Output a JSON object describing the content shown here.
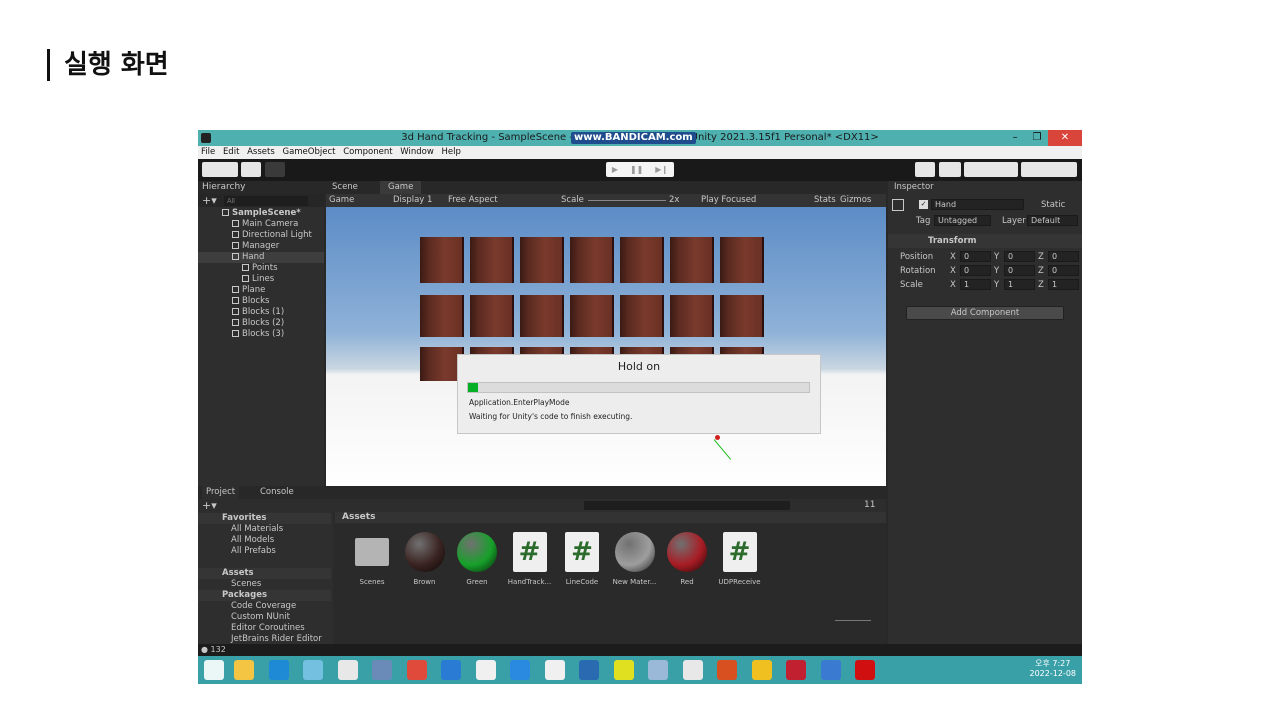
{
  "slide": {
    "title": "실행 화면"
  },
  "window": {
    "title": "3d Hand Tracking - SampleScene - Windows, Mac, Linux - Unity 2021.3.15f1 Personal* <DX11>",
    "watermark": "www.BANDICAM.com",
    "controls": [
      "–",
      "❐",
      "✕"
    ]
  },
  "menu": [
    "File",
    "Edit",
    "Assets",
    "GameObject",
    "Component",
    "Window",
    "Help"
  ],
  "hierarchy": {
    "tab": "Hierarchy",
    "search_placeholder": "All",
    "items": [
      {
        "label": "SampleScene*",
        "level": 0,
        "bold": true
      },
      {
        "label": "Main Camera",
        "level": 1
      },
      {
        "label": "Directional Light",
        "level": 1
      },
      {
        "label": "Manager",
        "level": 1
      },
      {
        "label": "Hand",
        "level": 1,
        "selected": true
      },
      {
        "label": "Points",
        "level": 2
      },
      {
        "label": "Lines",
        "level": 2
      },
      {
        "label": "Plane",
        "level": 1
      },
      {
        "label": "Blocks",
        "level": 1
      },
      {
        "label": "Blocks (1)",
        "level": 1
      },
      {
        "label": "Blocks (2)",
        "level": 1
      },
      {
        "label": "Blocks (3)",
        "level": 1
      }
    ]
  },
  "gameview": {
    "tabs": [
      "Scene",
      "Game"
    ],
    "mode": "Game",
    "display": "Display 1",
    "aspect": "Free Aspect",
    "scale_label": "Scale",
    "scale_value": "2x",
    "play_focused": "Play Focused",
    "stats": "Stats",
    "gizmos": "Gizmos"
  },
  "dialog": {
    "title": "Hold on",
    "progress": 0.03,
    "line1": "Application.EnterPlayMode",
    "line2": "Waiting for Unity's code to finish executing."
  },
  "inspector": {
    "tab": "Inspector",
    "object_name": "Hand",
    "static_label": "Static",
    "tag_label": "Tag",
    "tag_value": "Untagged",
    "layer_label": "Layer",
    "layer_value": "Default",
    "component": "Transform",
    "rows": [
      {
        "label": "Position",
        "x": "0",
        "y": "0",
        "z": "0"
      },
      {
        "label": "Rotation",
        "x": "0",
        "y": "0",
        "z": "0"
      },
      {
        "label": "Scale",
        "x": "1",
        "y": "1",
        "z": "1"
      }
    ],
    "add_component": "Add Component"
  },
  "project": {
    "tabs": [
      "Project",
      "Console"
    ],
    "favorites": "Favorites",
    "favorite_items": [
      "All Materials",
      "All Models",
      "All Prefabs"
    ],
    "assets_root": "Assets",
    "asset_folders": [
      "Scenes"
    ],
    "packages": "Packages",
    "package_items": [
      "Code Coverage",
      "Custom NUnit",
      "Editor Coroutines",
      "JetBrains Rider Editor"
    ],
    "breadcrumb": "Assets",
    "hidden_count": "11",
    "assets": [
      {
        "name": "Scenes",
        "kind": "folder"
      },
      {
        "name": "Brown",
        "kind": "material",
        "color": "#3a2320"
      },
      {
        "name": "Green",
        "kind": "material",
        "color": "#17a02a"
      },
      {
        "name": "HandTrack...",
        "kind": "script"
      },
      {
        "name": "LineCode",
        "kind": "script"
      },
      {
        "name": "New Mater...",
        "kind": "material",
        "color": "#9e9e9e"
      },
      {
        "name": "Red",
        "kind": "material",
        "color": "#a81c24"
      },
      {
        "name": "UDPReceive",
        "kind": "script"
      }
    ]
  },
  "status": {
    "count": "132"
  },
  "taskbar": {
    "time": "오후 7:27",
    "date": "2022-12-08"
  }
}
